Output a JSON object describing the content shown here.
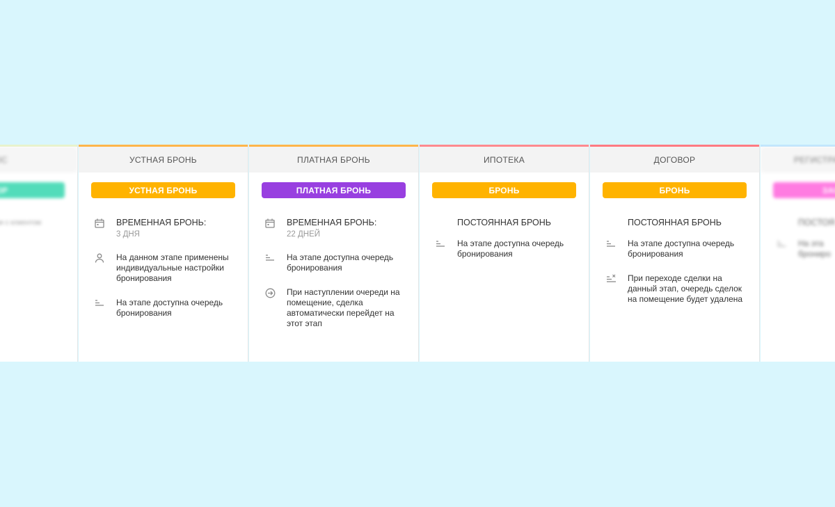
{
  "columns": [
    {
      "header": "ГОЛОС",
      "accent": "#e6f3c4",
      "tag": {
        "label": "ОБЗОР",
        "color": "#1ad1a4"
      },
      "rows": [
        {
          "icon": "",
          "text": "нии с клиентом"
        }
      ]
    },
    {
      "header": "УСТНАЯ БРОНЬ",
      "accent": "#ffb54a",
      "tag": {
        "label": "УСТНАЯ БРОНЬ",
        "color": "#ffb300"
      },
      "rows": [
        {
          "icon": "calendar-icon",
          "title": "ВРЕМЕННАЯ БРОНЬ:",
          "sub": "3 ДНЯ"
        },
        {
          "icon": "person-icon",
          "text": "На данном этапе применены индивидуальные настройки бронирования"
        },
        {
          "icon": "queue-icon",
          "text": "На этапе доступна очередь бронирования"
        }
      ]
    },
    {
      "header": "ПЛАТНАЯ БРОНЬ",
      "accent": "#ffb54a",
      "tag": {
        "label": "ПЛАТНАЯ БРОНЬ",
        "color": "#983fe0"
      },
      "rows": [
        {
          "icon": "calendar-icon",
          "title": "ВРЕМЕННАЯ БРОНЬ:",
          "sub": "22 ДНЕЙ"
        },
        {
          "icon": "queue-icon",
          "text": "На этапе доступна очередь бронирования"
        },
        {
          "icon": "arrow-circle-icon",
          "text": "При наступлении очереди на помещение, сделка автоматически перейдет на этот этап"
        }
      ]
    },
    {
      "header": "ИПОТЕКА",
      "accent": "#ff8a8f",
      "tag": {
        "label": "БРОНЬ",
        "color": "#ffb300"
      },
      "rows": [
        {
          "icon": "",
          "title": "ПОСТОЯННАЯ БРОНЬ"
        },
        {
          "icon": "queue-icon",
          "text": "На этапе доступна очередь бронирования"
        }
      ]
    },
    {
      "header": "ДОГОВОР",
      "accent": "#ff7a82",
      "tag": {
        "label": "БРОНЬ",
        "color": "#ffb300"
      },
      "rows": [
        {
          "icon": "",
          "title": "ПОСТОЯННАЯ БРОНЬ"
        },
        {
          "icon": "queue-icon",
          "text": "На этапе доступна очередь бронирования"
        },
        {
          "icon": "queue-remove-icon",
          "text": "При переходе сделки на данный этап, очередь сделок на помещение будет удалена"
        }
      ]
    },
    {
      "header": "РЕГИСТРА",
      "accent": "#b9e4ff",
      "tag": {
        "label": "ЗАСТАВКА",
        "color": "#ff4fd8"
      },
      "rows": [
        {
          "icon": "",
          "title": "ПОСТОЯ"
        },
        {
          "icon": "queue-icon",
          "text": "На эта брониро"
        }
      ]
    }
  ]
}
